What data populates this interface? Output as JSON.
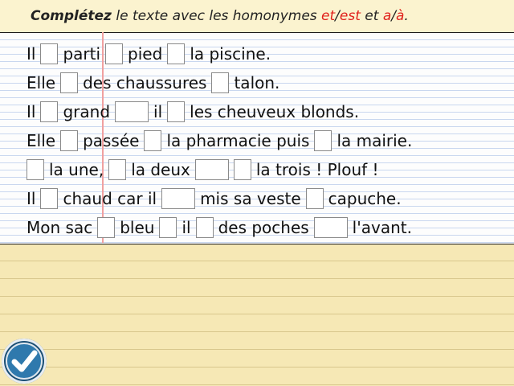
{
  "instruction": {
    "bold": "Complétez",
    "text": " le texte avec les homonymes ",
    "h1": "et",
    "sep1": "/",
    "h2": "est",
    "and": " et ",
    "h3": "a",
    "sep2": "/",
    "h4": "à",
    "end": "."
  },
  "sentences": [
    [
      {
        "t": "Il"
      },
      {
        "b": "s"
      },
      {
        "t": "parti"
      },
      {
        "b": "s"
      },
      {
        "t": "pied"
      },
      {
        "b": "s"
      },
      {
        "t": "la piscine."
      }
    ],
    [
      {
        "t": "Elle"
      },
      {
        "b": "s"
      },
      {
        "t": "des chaussures"
      },
      {
        "b": "s"
      },
      {
        "t": "talon."
      }
    ],
    [
      {
        "t": "Il"
      },
      {
        "b": "s"
      },
      {
        "t": "grand"
      },
      {
        "b": "m"
      },
      {
        "t": "il"
      },
      {
        "b": "s"
      },
      {
        "t": "les cheuveux blonds."
      }
    ],
    [
      {
        "t": "Elle"
      },
      {
        "b": "s"
      },
      {
        "t": "passée"
      },
      {
        "b": "s"
      },
      {
        "t": "la pharmacie puis"
      },
      {
        "b": "s"
      },
      {
        "t": "la mairie."
      }
    ],
    [
      {
        "b": "s"
      },
      {
        "t": "la une,"
      },
      {
        "b": "s"
      },
      {
        "t": "la deux"
      },
      {
        "b": "m"
      },
      {
        "b": "s"
      },
      {
        "t": "la trois ! Plouf !"
      }
    ],
    [
      {
        "t": "Il"
      },
      {
        "b": "s"
      },
      {
        "t": "chaud car il"
      },
      {
        "b": "m"
      },
      {
        "t": "mis sa veste"
      },
      {
        "b": "s"
      },
      {
        "t": "capuche."
      }
    ],
    [
      {
        "t": "Mon sac"
      },
      {
        "b": "s"
      },
      {
        "t": "bleu"
      },
      {
        "b": "s"
      },
      {
        "t": "il"
      },
      {
        "b": "s"
      },
      {
        "t": "des poches"
      },
      {
        "b": "m"
      },
      {
        "t": "l'avant."
      }
    ]
  ],
  "check_icon": "check-icon",
  "colors": {
    "accent_red": "#e0201b",
    "button_blue": "#2f79ad"
  }
}
